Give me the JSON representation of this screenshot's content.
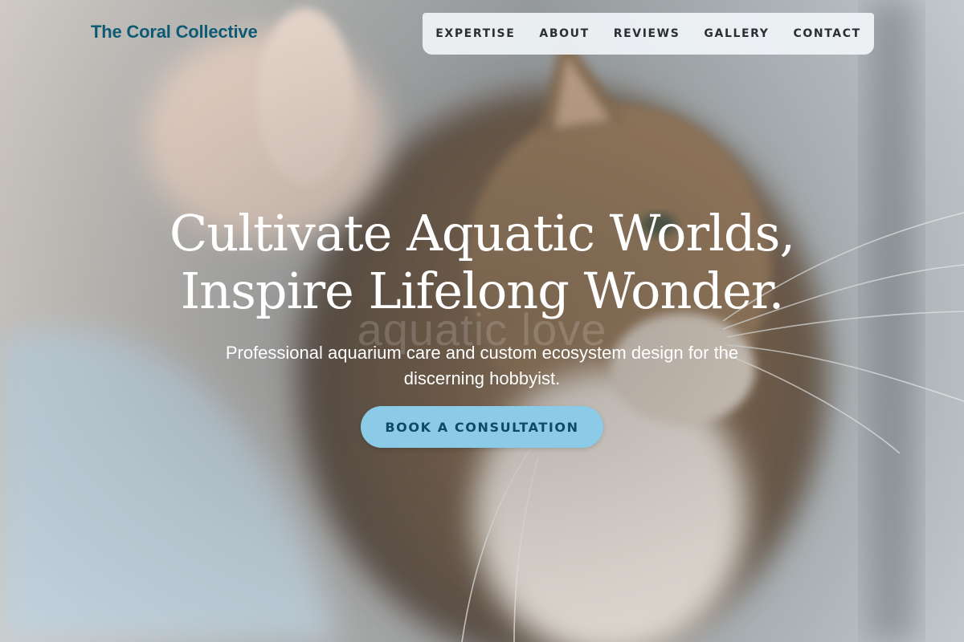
{
  "brand": {
    "name": "The Coral Collective",
    "color": "#0d5a74"
  },
  "nav": {
    "items": [
      {
        "label": "EXPERTISE"
      },
      {
        "label": "ABOUT"
      },
      {
        "label": "REVIEWS"
      },
      {
        "label": "GALLERY"
      },
      {
        "label": "CONTACT"
      }
    ]
  },
  "hero": {
    "headline_line1": "Cultivate Aquatic Worlds,",
    "headline_line2": "Inspire Lifelong Wonder.",
    "watermark": "aquatic love",
    "subtitle": "Professional aquarium care and custom ecosystem design for the discerning hobbyist.",
    "cta_label": "BOOK A CONSULTATION",
    "cta_color": "#8bcbe8",
    "background_image": "cat-being-petted-photo"
  }
}
